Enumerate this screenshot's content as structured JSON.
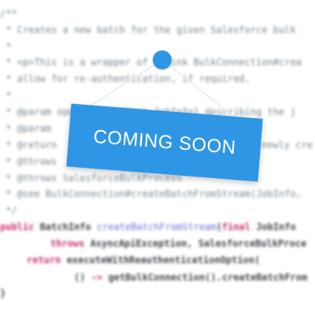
{
  "overlay": {
    "sign_text": "COMING SOON",
    "pin_icon": "pushpin-icon",
    "accent_color": "#2f96e6"
  },
  "code": {
    "l1": "/**",
    "l2": " * Creates a new batch for the given Salesforce bulk",
    "l3": " *",
    "l4": " * <p>This is a wrapper of {@link BulkConnection#crea",
    "l5": " * allow for re-authentication, if required.",
    "l6": " *",
    "l7": " * @param openedJob {@link JobInfo} describing the j",
    "l8": " * @param",
    "l9": " * @return",
    "l9b": "newly cre",
    "l10": " * @throws",
    "l11": " * @throws SalesforceBulkProcess",
    "l12": " * @see BulkConnection#createBatchFromStream(JobInfo,",
    "l13": " */",
    "l14_kw": "public",
    "l14_type": " BatchInfo ",
    "l14_fn": "createBatchFromStream",
    "l14_rest": "(",
    "l14_final": "final",
    "l14_tail": " JobInfo",
    "l15_kw": "throws",
    "l15_tail": " AsyncApiException, SalesforceBulkProce",
    "l16_kw": "return",
    "l16_tail": " executeWithReauthenticationOption(",
    "l17_pre": "() ",
    "l17_arrow": "->",
    "l17_tail": " getBulkConnection().createBatchFrom",
    "l18": "}"
  }
}
